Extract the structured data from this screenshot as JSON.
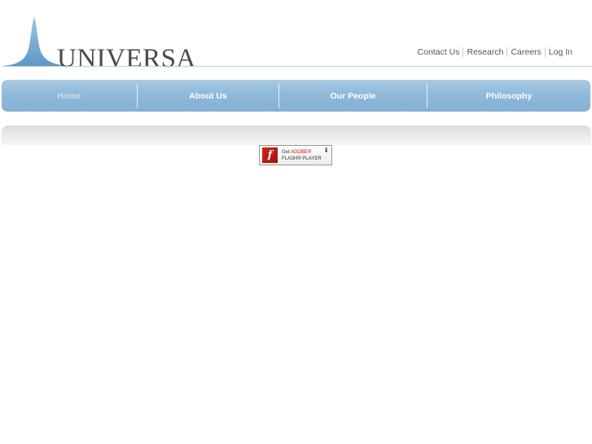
{
  "header": {
    "logo_text": "UNIVERSA",
    "top_links": [
      {
        "label": "Contact Us"
      },
      {
        "label": "Research"
      },
      {
        "label": "Careers"
      },
      {
        "label": "Log In"
      }
    ]
  },
  "nav": {
    "items": [
      {
        "label": "Home",
        "active": true
      },
      {
        "label": "About Us"
      },
      {
        "label": "Our People"
      },
      {
        "label": "Philosophy"
      }
    ]
  },
  "flash_badge": {
    "line1_prefix": "Get ",
    "line1_brand": "ADOBE®",
    "line2": "FLASH® PLAYER",
    "icon": "flash-f-icon",
    "download_icon": "download-arrow-icon"
  },
  "colors": {
    "nav_blue": "#8fb8d9",
    "logo_blue": "#6fa3cc",
    "flash_red": "#c81a14"
  }
}
